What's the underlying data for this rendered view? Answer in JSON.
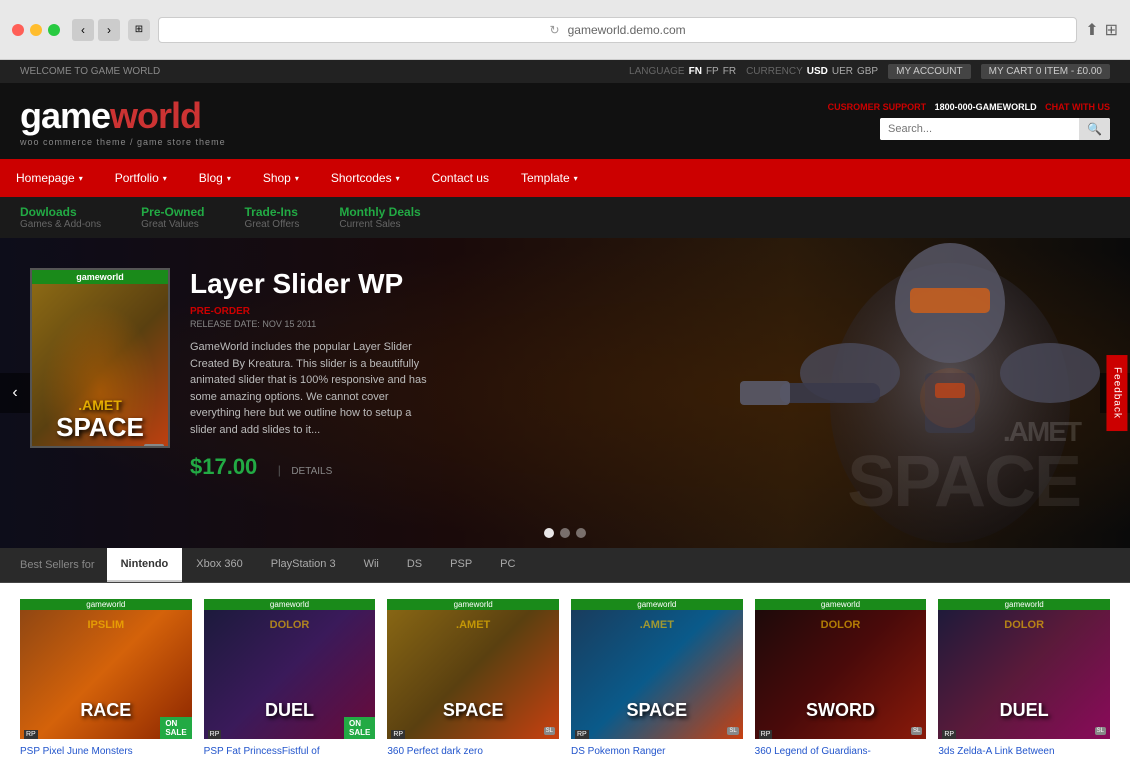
{
  "browser": {
    "address": "gameworld.demo.com",
    "reload_icon": "↻"
  },
  "topbar": {
    "welcome": "WELCOME TO GAME WORLD",
    "language_label": "LANGUAGE",
    "langs": [
      "FN",
      "FP",
      "FR"
    ],
    "currency_label": "CURRENCY",
    "currencies": [
      "USD",
      "UER",
      "GBP"
    ],
    "my_account": "MY ACCOUNT",
    "cart": "MY CART",
    "cart_info": "0 ITEM - £0.00"
  },
  "header": {
    "logo_main": "gameworld",
    "logo_sub": "woo commerce theme / game store theme",
    "support_label": "CUSROMER SUPPORT",
    "support_phone": "1800-000-GAMEWORLD",
    "chat": "CHAT WITH US",
    "search_placeholder": "Search..."
  },
  "nav": {
    "items": [
      {
        "label": "Homepage",
        "has_arrow": true
      },
      {
        "label": "Portfolio",
        "has_arrow": true
      },
      {
        "label": "Blog",
        "has_arrow": true
      },
      {
        "label": "Shop",
        "has_arrow": true
      },
      {
        "label": "Shortcodes",
        "has_arrow": true
      },
      {
        "label": "Contact us",
        "has_arrow": false
      },
      {
        "label": "Template",
        "has_arrow": true
      }
    ]
  },
  "subnav": {
    "items": [
      {
        "title": "Dowloads",
        "desc": "Games & Add-ons"
      },
      {
        "title": "Pre-Owned",
        "desc": "Great Values"
      },
      {
        "title": "Trade-Ins",
        "desc": "Great Offers"
      },
      {
        "title": "Monthly Deals",
        "desc": "Current Sales"
      }
    ]
  },
  "hero": {
    "game_label": "gameworld",
    "title": "Layer Slider WP",
    "preorder": "PRE-ORDER",
    "date": "RELEASE DATE: NOV 15 2011",
    "description": "GameWorld includes the popular Layer Slider Created By Kreatura.  This slider is a beautifully animated slider that is 100% responsive and  has some amazing options.  We cannot cover everything here but we outline how to setup a slider and add slides to it...",
    "price": "$17.00",
    "details_link": "DETAILS",
    "cover_title": ".amet",
    "cover_sub": "SPACE",
    "watermark_amet": ".amet",
    "watermark_space": "SPACE",
    "feedback": "Feedback"
  },
  "best_sellers": {
    "label": "Best Sellers for",
    "tabs": [
      "Nintendo",
      "Xbox 360",
      "PlayStation 3",
      "Wii",
      "DS",
      "PSP",
      "PC"
    ]
  },
  "products": [
    {
      "id": 1,
      "title": "PSP Pixel June Monsters",
      "cover_main": "IPSLIM",
      "cover_sub": "RACE",
      "badge": "ON SALE",
      "color_class": "cover-1"
    },
    {
      "id": 2,
      "title": "PSP Fat PrincessFistful of",
      "cover_main": "dolor",
      "cover_sub": "DUEL",
      "badge": "ON SALE",
      "color_class": "cover-2"
    },
    {
      "id": 3,
      "title": "360 Perfect dark zero",
      "cover_main": ".amet",
      "cover_sub": "SPACE",
      "badge": "",
      "color_class": "cover-3"
    },
    {
      "id": 4,
      "title": "DS Pokemon Ranger",
      "cover_main": ".amet",
      "cover_sub": "SPACE",
      "badge": "",
      "color_class": "cover-4"
    },
    {
      "id": 5,
      "title": "360 Legend of Guardians-",
      "cover_main": "dolor",
      "cover_sub": "SWORD",
      "badge": "",
      "color_class": "cover-5"
    },
    {
      "id": 6,
      "title": "3ds Zelda-A Link Between",
      "cover_main": "dolor",
      "cover_sub": "DUEL",
      "badge": "",
      "color_class": "cover-6"
    }
  ]
}
